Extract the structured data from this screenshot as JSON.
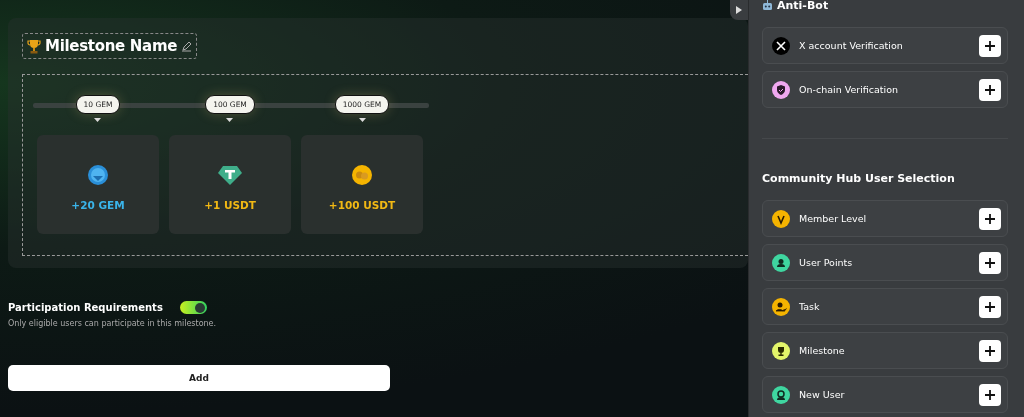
{
  "milestone": {
    "title": "Milestone Name",
    "tiers": [
      {
        "threshold": "10 GEM",
        "reward": "+20 GEM",
        "kind": "gem"
      },
      {
        "threshold": "100 GEM",
        "reward": "+1 USDT",
        "kind": "usdt"
      },
      {
        "threshold": "1000 GEM",
        "reward": "+100 USDT",
        "kind": "coin"
      }
    ]
  },
  "requirements": {
    "label": "Participation Requirements",
    "on": true,
    "description": "Only eligible users can participate in this milestone."
  },
  "add_button": "Add",
  "panel": {
    "sections": [
      {
        "title": "Anti-Bot",
        "items": [
          {
            "label": "X account Verification",
            "kind": "x",
            "color": "#000000"
          },
          {
            "label": "On-chain Verification",
            "kind": "shield",
            "color": "#f0a8f0"
          }
        ]
      },
      {
        "title": "Community Hub User Selection",
        "items": [
          {
            "label": "Member Level",
            "kind": "v",
            "color": "#f5b400"
          },
          {
            "label": "User Points",
            "kind": "user",
            "color": "#3fd6a0"
          },
          {
            "label": "Task",
            "kind": "task",
            "color": "#f5b400"
          },
          {
            "label": "Milestone",
            "kind": "trophy",
            "color": "#e3f56a"
          },
          {
            "label": "New User",
            "kind": "newuser",
            "color": "#3fd6a0"
          }
        ]
      }
    ]
  }
}
